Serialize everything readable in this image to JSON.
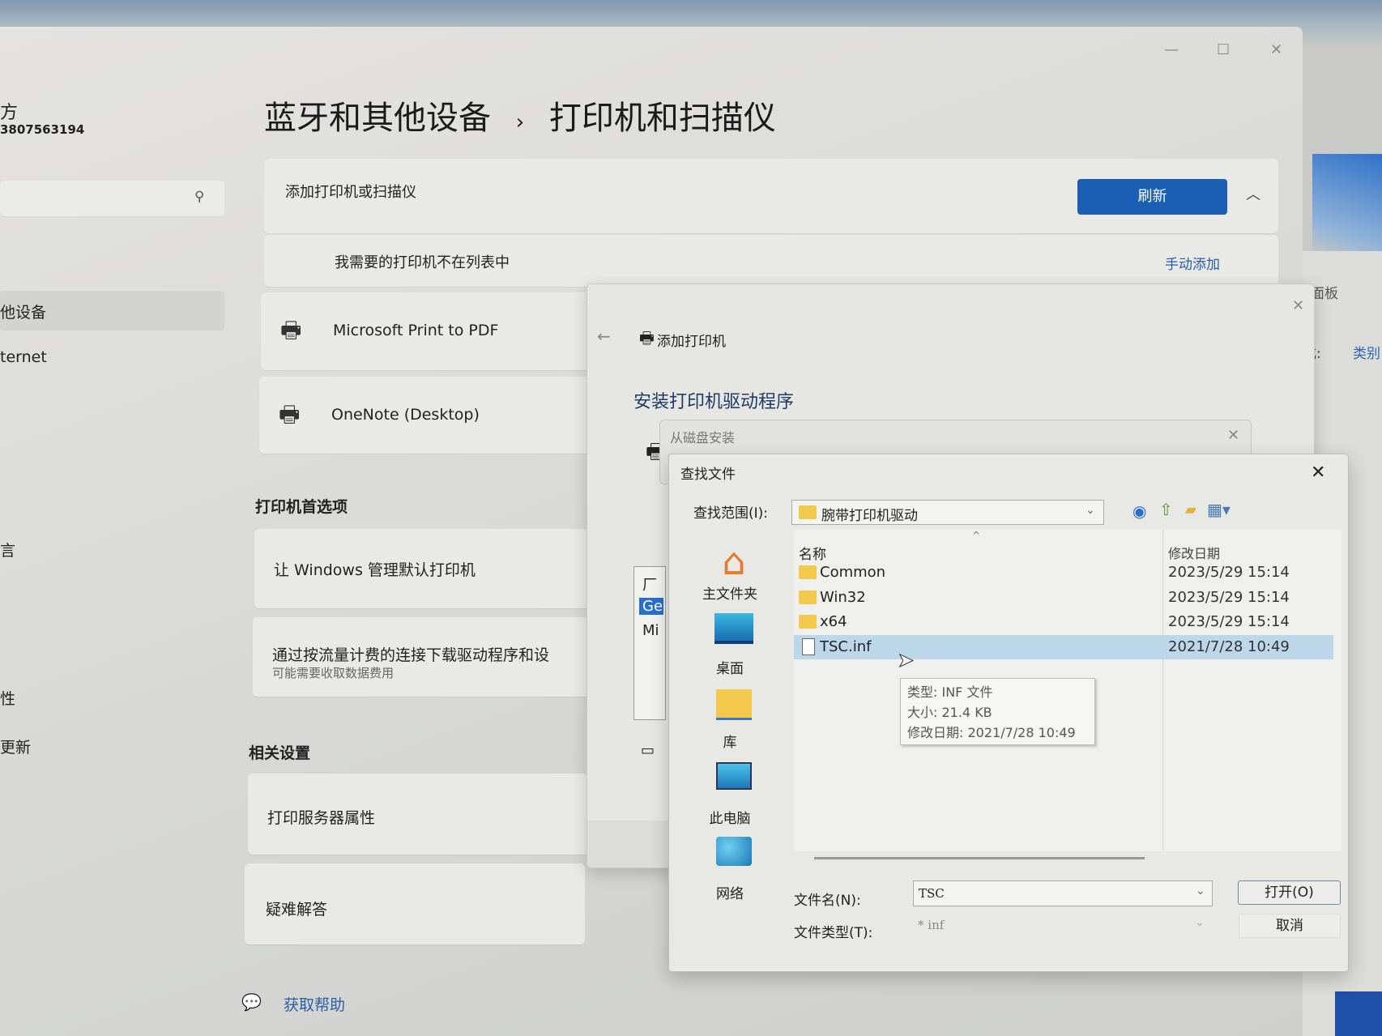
{
  "settings": {
    "breadcrumb": {
      "parent": "蓝牙和其他设备",
      "separator": "›",
      "current": "打印机和扫描仪"
    },
    "account": {
      "name_partial": "方",
      "id_partial": "3807563194"
    },
    "sidebar": {
      "items": [
        {
          "label": "他设备",
          "selected": true
        },
        {
          "label": "ternet"
        },
        {
          "label": "言"
        },
        {
          "label": "性"
        },
        {
          "label": "更新"
        }
      ]
    },
    "add_section": {
      "label": "添加打印机或扫描仪",
      "refresh": "刷新",
      "not_listed": "我需要的打印机不在列表中",
      "manual_add": "手动添加"
    },
    "printers": [
      {
        "name": "Microsoft Print to PDF"
      },
      {
        "name": "OneNote (Desktop)"
      }
    ],
    "prefs": {
      "heading": "打印机首选项",
      "let_windows": "让 Windows 管理默认打印机",
      "metered": "通过按流量计费的连接下载驱动程序和设",
      "metered_sub": "可能需要收取数据费用"
    },
    "related": {
      "heading": "相关设置",
      "server": "打印服务器属性",
      "troubleshoot": "疑难解答"
    },
    "help": "获取帮助"
  },
  "right_window": {
    "text1": "面板",
    "text2": "式:",
    "link": "类别"
  },
  "add_printer": {
    "title": "添加打印机",
    "heading": "安装打印机驱动程序",
    "list_partial": [
      "厂",
      "Ge",
      "Mi"
    ]
  },
  "disk_dialog": {
    "title": "从磁盘安装"
  },
  "find_dialog": {
    "title": "查找文件",
    "lookin_label": "查找范围(I):",
    "lookin_value": "腕带打印机驱动",
    "places": [
      "主文件夹",
      "桌面",
      "库",
      "此电脑",
      "网络"
    ],
    "columns": [
      "名称",
      "修改日期"
    ],
    "files": [
      {
        "name": "Common",
        "date": "2023/5/29 15:14",
        "type": "folder"
      },
      {
        "name": "Win32",
        "date": "2023/5/29 15:14",
        "type": "folder"
      },
      {
        "name": "x64",
        "date": "2023/5/29 15:14",
        "type": "folder"
      },
      {
        "name": "TSC.inf",
        "date": "2021/7/28 10:49",
        "type": "file",
        "selected": true
      }
    ],
    "tooltip": {
      "type": "类型: INF 文件",
      "size": "大小: 21.4 KB",
      "modified": "修改日期: 2021/7/28 10:49"
    },
    "filename_label": "文件名(N):",
    "filename_value": "TSC",
    "filetype_label": "文件类型(T):",
    "filetype_value": "* inf",
    "open": "打开(O)",
    "cancel": "取消"
  },
  "colors": {
    "accent": "#1a5fb4",
    "selection": "#bcd6ea"
  }
}
